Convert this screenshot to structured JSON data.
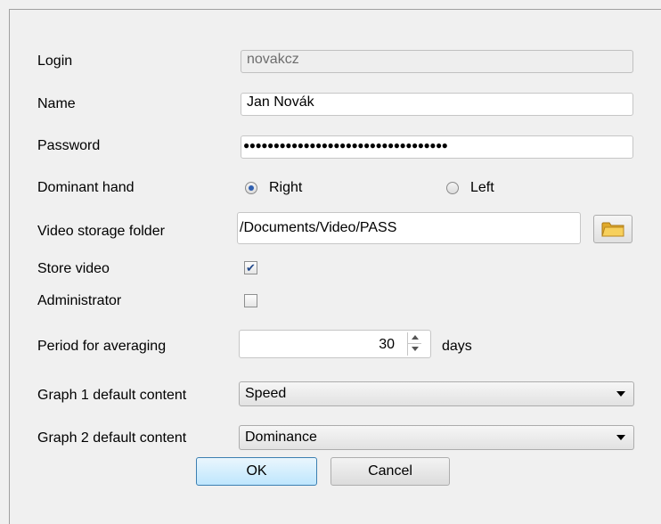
{
  "form": {
    "login": {
      "label": "Login",
      "value": "novakcz"
    },
    "name": {
      "label": "Name",
      "value": "Jan Novák"
    },
    "password": {
      "label": "Password",
      "value": "●●●●●●●●●●●●●●●●●●●●●●●●●●●●●●●●●●"
    },
    "dominant_hand": {
      "label": "Dominant hand",
      "options": [
        "Right",
        "Left"
      ],
      "selected": "Right"
    },
    "video_folder": {
      "label": "Video storage folder",
      "value": "/Documents/Video/PASS",
      "icon": "folder-icon"
    },
    "store_video": {
      "label": "Store video",
      "checked": true
    },
    "administrator": {
      "label": "Administrator",
      "checked": false
    },
    "period": {
      "label": "Period for averaging",
      "value": "30",
      "unit": "days"
    },
    "graph1": {
      "label": "Graph 1 default content",
      "value": "Speed"
    },
    "graph2": {
      "label": "Graph 2 default content",
      "value": "Dominance"
    }
  },
  "buttons": {
    "ok": "OK",
    "cancel": "Cancel"
  },
  "colors": {
    "accent": "#2f5fb0",
    "folder": "#f3c545",
    "default_button_border": "#3c7fb1"
  }
}
